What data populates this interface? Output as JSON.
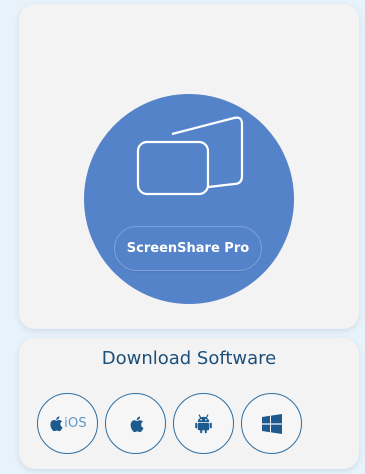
{
  "app": {
    "name": "ScreenShare Pro"
  },
  "download": {
    "title": "Download Software",
    "platforms": [
      {
        "id": "ios",
        "label": "iOS",
        "icon": "apple-icon"
      },
      {
        "id": "mac",
        "label": "",
        "icon": "apple-icon"
      },
      {
        "id": "android",
        "label": "",
        "icon": "android-icon"
      },
      {
        "id": "windows",
        "label": "",
        "icon": "windows-icon"
      }
    ]
  },
  "colors": {
    "accent": "#5583c9",
    "title": "#1d4f7a",
    "icon": "#1d5b8e"
  }
}
